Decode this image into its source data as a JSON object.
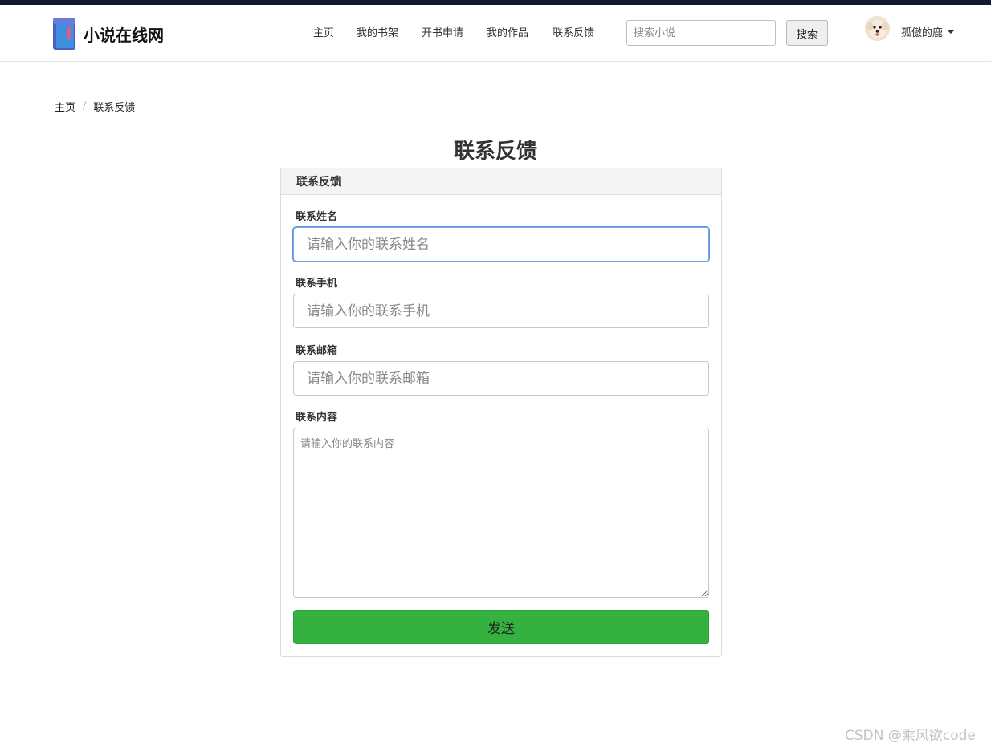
{
  "brand": {
    "name": "小说在线网"
  },
  "nav": {
    "links": [
      "主页",
      "我的书架",
      "开书申请",
      "我的作品",
      "联系反馈"
    ]
  },
  "search": {
    "placeholder": "搜索小说",
    "button_label": "搜索"
  },
  "user": {
    "name": "孤傲的鹿"
  },
  "breadcrumb": {
    "home": "主页",
    "separator": "/",
    "current": "联系反馈"
  },
  "page": {
    "title": "联系反馈"
  },
  "form": {
    "card_title": "联系反馈",
    "name": {
      "label": "联系姓名",
      "placeholder": "请输入你的联系姓名"
    },
    "phone": {
      "label": "联系手机",
      "placeholder": "请输入你的联系手机"
    },
    "email": {
      "label": "联系邮箱",
      "placeholder": "请输入你的联系邮箱"
    },
    "content": {
      "label": "联系内容",
      "placeholder": "请输入你的联系内容"
    },
    "submit_label": "发送"
  },
  "watermark": "CSDN @乘风欲code",
  "colors": {
    "topstrip": "#101a2c",
    "submit": "#34b13f",
    "focus": "#5b8fe0"
  }
}
